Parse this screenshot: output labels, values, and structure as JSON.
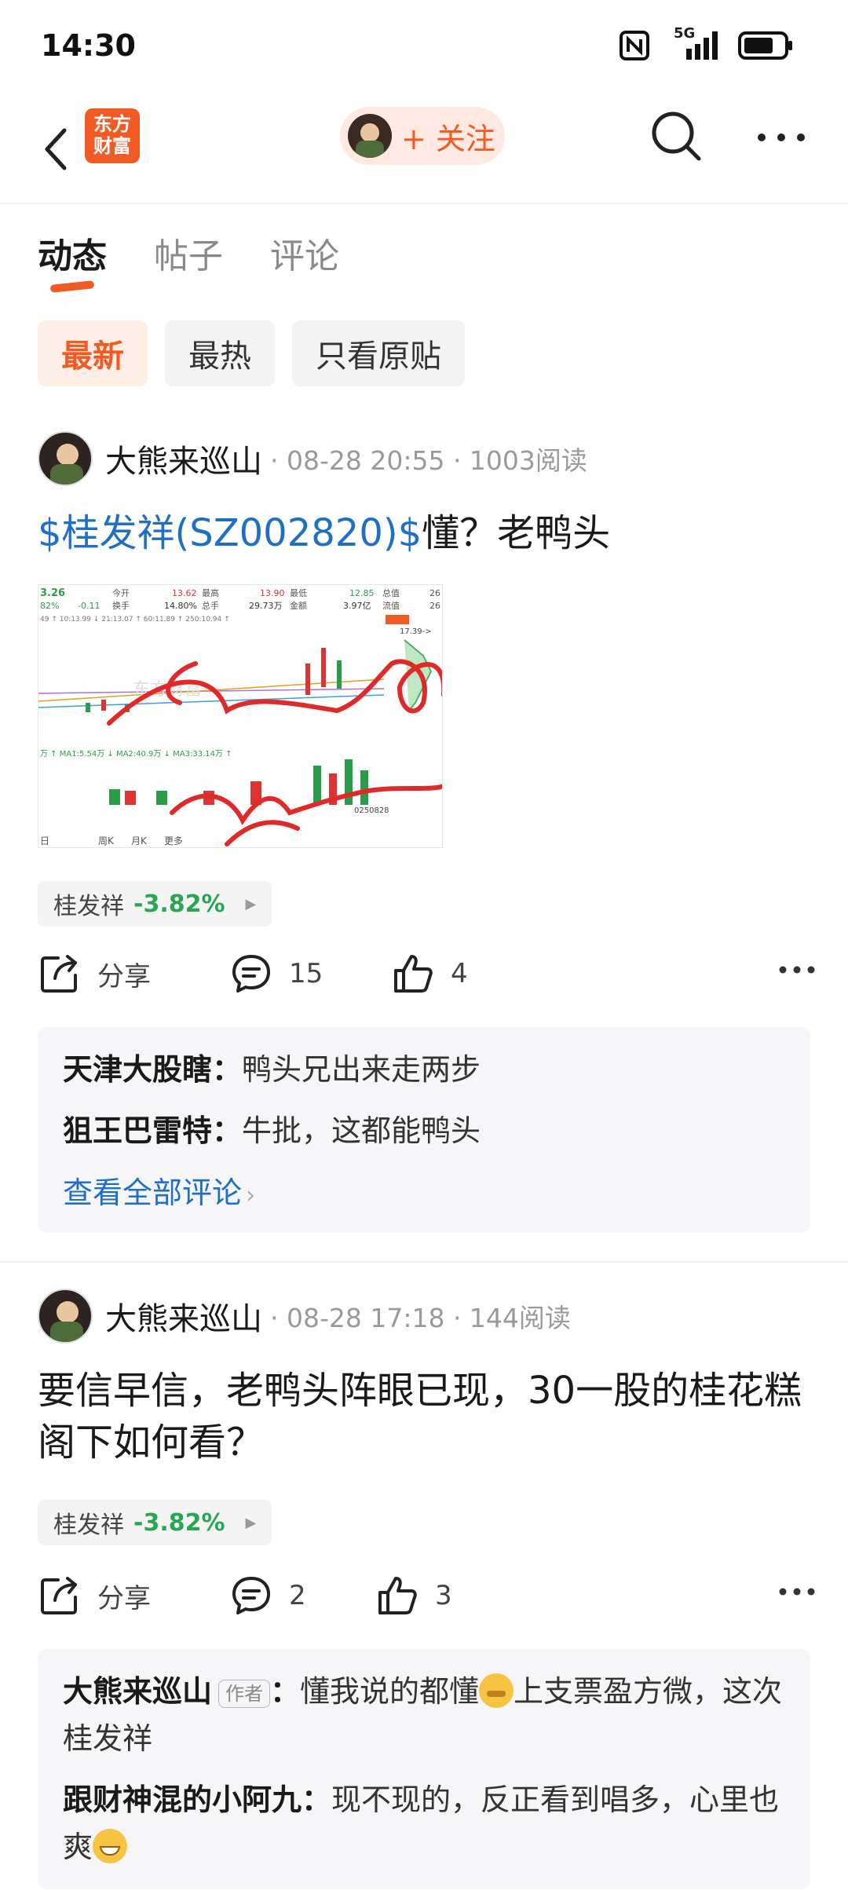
{
  "status": {
    "time": "14:30",
    "network": "5G"
  },
  "nav": {
    "logo_text": "东方\n财富",
    "follow_label": "+ 关注"
  },
  "tabs": [
    {
      "label": "动态",
      "active": true
    },
    {
      "label": "帖子",
      "active": false
    },
    {
      "label": "评论",
      "active": false
    }
  ],
  "filters": [
    {
      "label": "最新",
      "active": true
    },
    {
      "label": "最热",
      "active": false
    },
    {
      "label": "只看原贴",
      "active": false
    }
  ],
  "posts": [
    {
      "author": "大熊来巡山",
      "meta": "· 08-28 20:55 · 1003阅读",
      "stock_link": "$桂发祥(SZ002820)$",
      "text": "懂？老鸭头",
      "chart_image": {
        "header_values": [
          "3.26",
          "今开",
          "13.62",
          "最高",
          "13.90",
          "最低",
          "12.85",
          "总值",
          "26",
          "82%",
          "-0.11",
          "换手",
          "14.80%",
          "总手",
          "29.73万",
          "金额",
          "3.97亿",
          "流值",
          "26"
        ],
        "ma_line": "49 ↑ 10:13.99 ↓ 21:13.07 ↑ 60:11.89 ↑ 250:10.94 ↑",
        "price_marker": "17.39->",
        "vol_line": "万 ↑ MA1:5.54万 ↓ MA2:40.9万 ↓ MA3:33.14万 ↑",
        "date_code": "0250828",
        "tabs": [
          "日",
          "周K",
          "月K",
          "更多"
        ],
        "watermark": "东方财富"
      },
      "stock_tag": {
        "name": "桂发祥",
        "change": "-3.82%"
      },
      "share_label": "分享",
      "comments_count": "15",
      "likes_count": "4",
      "comments": [
        {
          "author": "天津大股瞎",
          "text": "鸭头兄出来走两步"
        },
        {
          "author": "狙王巴雷特",
          "text": "牛批，这都能鸭头"
        }
      ],
      "view_all": "查看全部评论"
    },
    {
      "author": "大熊来巡山",
      "meta": "· 08-28 17:18 · 144阅读",
      "text": "要信早信，老鸭头阵眼已现，30一股的桂花糕阁下如何看？",
      "stock_tag": {
        "name": "桂发祥",
        "change": "-3.82%"
      },
      "share_label": "分享",
      "comments_count": "2",
      "likes_count": "3",
      "comments": [
        {
          "author": "大熊来巡山",
          "badge": "作者",
          "text_a": "懂我说的都懂",
          "text_b": "上支票盈方微，这次桂发祥"
        },
        {
          "author": "跟财神混的小阿九",
          "text_a": "现不现的，反正看到唱多，心里也爽"
        }
      ]
    }
  ]
}
